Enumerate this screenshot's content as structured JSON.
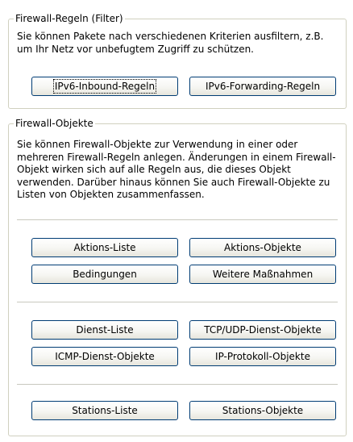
{
  "filter_group": {
    "title": "Firewall-Regeln (Filter)",
    "description": "Sie können Pakete nach verschiedenen Kriterien ausfiltern, z.B. um Ihr Netz vor unbefugtem Zugriff zu schützen.",
    "buttons": {
      "inbound": "IPv6-Inbound-Regeln",
      "forwarding": "IPv6-Forwarding-Regeln"
    }
  },
  "objects_group": {
    "title": "Firewall-Objekte",
    "description": "Sie können Firewall-Objekte zur Verwendung in einer oder mehreren Firewall-Regeln anlegen. Änderungen in einem Firewall-Objekt wirken sich auf alle Regeln aus, die dieses Objekt verwenden. Darüber hinaus können Sie auch Firewall-Objekte zu Listen von Objekten zusammenfassen.",
    "buttons": {
      "aktions_liste": "Aktions-Liste",
      "aktions_objekte": "Aktions-Objekte",
      "bedingungen": "Bedingungen",
      "weitere": "Weitere Maßnahmen",
      "dienst_liste": "Dienst-Liste",
      "tcp_udp": "TCP/UDP-Dienst-Objekte",
      "icmp": "ICMP-Dienst-Objekte",
      "ip_protokoll": "IP-Protokoll-Objekte",
      "stations_liste": "Stations-Liste",
      "stations_objekte": "Stations-Objekte"
    }
  }
}
